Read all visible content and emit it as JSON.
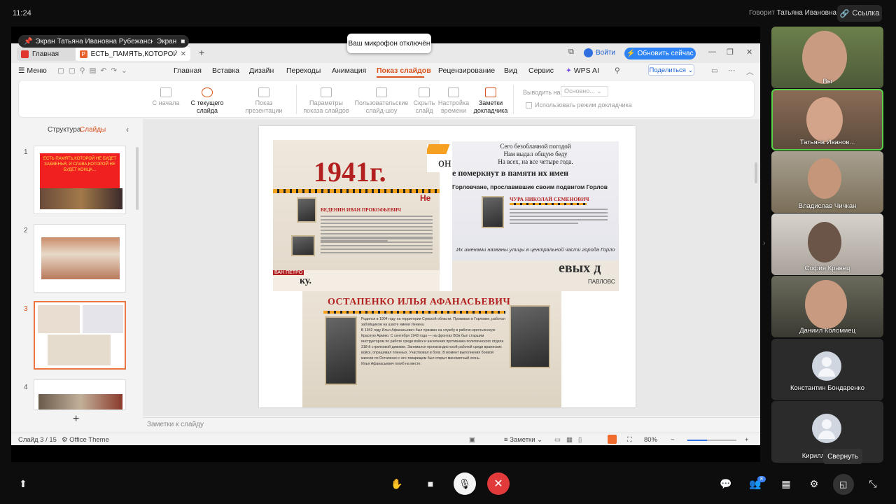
{
  "status": {
    "time": "11:24",
    "speaking_prefix": "Говорит",
    "speaking_name": "Татьяна Ивановна Р.",
    "link_label": "Ссылка"
  },
  "share": {
    "presenter": "Экран Татьяна Ивановна Рубежанская",
    "screen_label": "Экран",
    "mic_toast": "Ваш микрофон отключён"
  },
  "wps": {
    "tabs": [
      {
        "label": "Главная"
      },
      {
        "label": "ЕСТЬ_ПАМЯТЬ,КОТОРОЙ_НЕ_"
      }
    ],
    "login": "Войти",
    "update": "Обновить сейчас",
    "menu": {
      "hamburger": "Меню",
      "items": [
        "Главная",
        "Вставка",
        "Дизайн",
        "Переходы",
        "Анимация",
        "Показ слайдов",
        "Рецензирование",
        "Вид",
        "Сервис",
        "WPS AI"
      ],
      "share_button": "Поделиться"
    },
    "ribbon": {
      "from_start": "С начала",
      "from_current": "С текущего слайда",
      "show_presentation": "Показ презентации",
      "params1": "Параметры",
      "params2": "показа слайдов",
      "custom1": "Пользовательские",
      "custom2": "слайд-шоу",
      "hide1": "Скрыть",
      "hide2": "слайд",
      "timing1": "Настройка",
      "timing2": "времени",
      "notes1": "Заметки",
      "notes2": "докладчика",
      "output_label": "Выводить на:",
      "output_value": "Основно...",
      "presenter_mode": "Использовать режим докладчика"
    },
    "left_panel": {
      "structure": "Структура",
      "slides": "Слайды",
      "thumb1_text": "ЕСТЬ ПАМЯТЬ,КОТОРОЙ НЕ БУДЕТ ЗАБВЕНЬЯ, И СЛАВА,КОТОРОЙ НЕ БУДЕТ КОНЦА...",
      "numbers": [
        "1",
        "2",
        "3",
        "4"
      ],
      "add": "+"
    },
    "slide": {
      "year": "1941г.",
      "name1": "ВЕДЕНИН ИВАН ПРОКОФЬЕВИЧ",
      "poem1": "Сего безоблачной погодой",
      "poem2": "Нам выдал общую беду",
      "poem3": "На всех, на все четыре года.",
      "headline": "е померкнут в памяти их имен",
      "sub": "Горловчане, прославившие своим подвигом Горлов",
      "name2": "ЧУРА НИКОЛАЙ СЕМЕНОВИЧ",
      "streets": "Их именами названы улицы в центральной части города Горло",
      "name3": "ОСТАПЕНКО ИЛЬЯ АФАНАСЬЕВИЧ",
      "frag1": "он",
      "frag2": "Не",
      "frag3": "евых д",
      "frag4": "ПАВЛОВС",
      "frag5": "ВАН ПЕТРО",
      "frag6": "ку.",
      "bio1": "Родился в 1904 году на территории Сумской области. Проживал в Горловке, работал",
      "bio2": "забойщиком на шахте имени Ленина.",
      "bio3": "В 1942 году Илья Афанасьевич был призван на службу в рабоче-крестьянскую",
      "bio4": "Красную Армию. С сентября 1943 года — на фронтах ВОв был старшим",
      "bio5": "инструктором по работе среди войск и населения противника политического отдела",
      "bio6": "318-й стрелковой дивизии. Занимался пропагандистской работой среди вражеских",
      "bio7": "войск, опрашивал пленных. Участвовал в боях. В момент выполнения боевой",
      "bio8": "миссии по Остапенко с его товарищем был открыт минометный огонь.",
      "bio9": "Илья Афанасьевич погиб на месте."
    },
    "notes_placeholder": "Заметки к слайду",
    "statusbar": {
      "slide_counter": "Слайд 3 / 15",
      "theme": "Office Theme",
      "notes": "Заметки",
      "zoom": "80%",
      "zoom_level": 0.4
    }
  },
  "participants": [
    {
      "name": "Вы"
    },
    {
      "name": "Татьяна Иванов..."
    },
    {
      "name": "Владислав Чичкан"
    },
    {
      "name": "София Кравец"
    },
    {
      "name": "Даниил Коломиец"
    },
    {
      "name": "Константин Бондаренко"
    },
    {
      "name": "Кирилл"
    }
  ],
  "toolbar": {
    "collapse_tooltip": "Свернуть",
    "participants_badge": "8"
  },
  "colors": {
    "accent": "#d8531d",
    "end_call": "#e23a3a",
    "speaking": "#5bd14a",
    "update": "#2f84f5"
  }
}
